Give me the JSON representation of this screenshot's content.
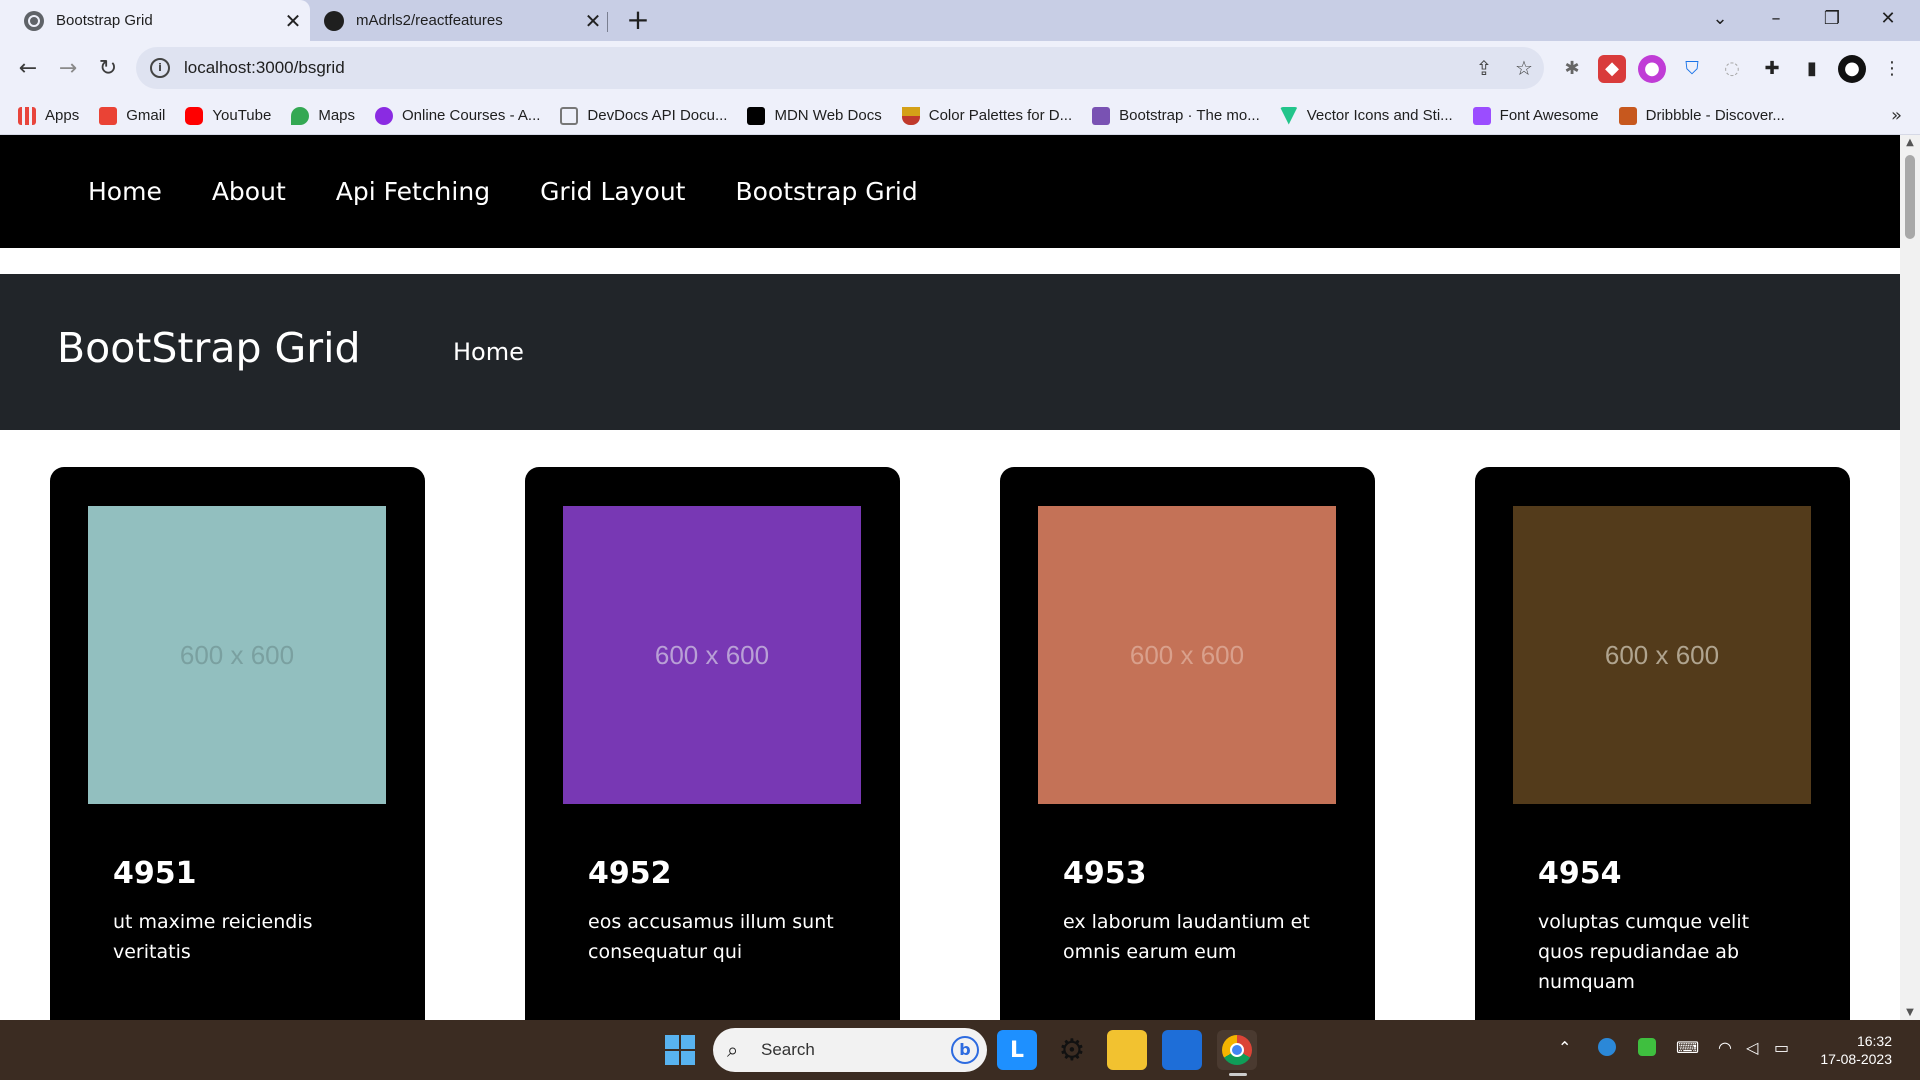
{
  "browser": {
    "tabs": [
      {
        "title": "Bootstrap Grid",
        "favicon": "globe-icon",
        "active": true
      },
      {
        "title": "mAdrls2/reactfeatures",
        "favicon": "github-icon",
        "active": false
      }
    ],
    "url": "localhost:3000/bsgrid",
    "bookmarks": [
      {
        "label": "Apps",
        "icon": "apps-grid-icon",
        "color": "#e8453c"
      },
      {
        "label": "Gmail",
        "icon": "gmail-icon",
        "color": "#ea4335"
      },
      {
        "label": "YouTube",
        "icon": "youtube-icon",
        "color": "#ff0000"
      },
      {
        "label": "Maps",
        "icon": "maps-icon",
        "color": "#34a853"
      },
      {
        "label": "Online Courses - A...",
        "icon": "courses-icon",
        "color": "#8a2be2"
      },
      {
        "label": "DevDocs API Docu...",
        "icon": "devdocs-icon",
        "color": "#777777"
      },
      {
        "label": "MDN Web Docs",
        "icon": "mdn-icon",
        "color": "#000000"
      },
      {
        "label": "Color Palettes for D...",
        "icon": "palette-icon",
        "color": "#d4a017"
      },
      {
        "label": "Bootstrap · The mo...",
        "icon": "bootstrap-icon",
        "color": "#7952b3"
      },
      {
        "label": "Vector Icons and Sti...",
        "icon": "vector-icon",
        "color": "#22c58b"
      },
      {
        "label": "Font Awesome",
        "icon": "fontawesome-icon",
        "color": "#9b4dff"
      },
      {
        "label": "Dribbble - Discover...",
        "icon": "dribbble-icon",
        "color": "#c7581e"
      }
    ]
  },
  "site": {
    "nav": [
      "Home",
      "About",
      "Api Fetching",
      "Grid Layout",
      "Bootstrap Grid"
    ],
    "hero": {
      "title": "BootStrap Grid",
      "link": "Home"
    },
    "cards": [
      {
        "id": "4951",
        "text": "ut maxime reiciendis veritatis",
        "image_label": "600 x 600",
        "image_color": "#92bfbf",
        "label_color": "#7aa0a0"
      },
      {
        "id": "4952",
        "text": "eos accusamus illum sunt consequatur qui",
        "image_label": "600 x 600",
        "image_color": "#7838b4",
        "label_color": "#b9a0d6"
      },
      {
        "id": "4953",
        "text": "ex laborum laudantium et omnis earum eum",
        "image_label": "600 x 600",
        "image_color": "#c47257",
        "label_color": "#d9a08c"
      },
      {
        "id": "4954",
        "text": "voluptas cumque velit quos repudiandae ab numquam",
        "image_label": "600 x 600",
        "image_color": "#533b1b",
        "label_color": "#b0a48f"
      }
    ]
  },
  "taskbar": {
    "search_placeholder": "Search",
    "time": "16:32",
    "date": "17-08-2023"
  }
}
